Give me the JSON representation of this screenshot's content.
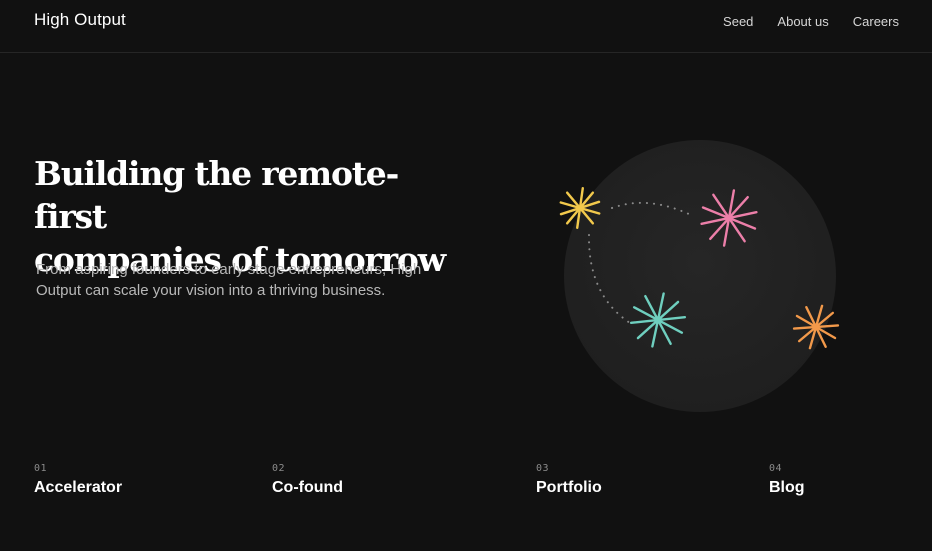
{
  "header": {
    "brand": "High Output",
    "nav": [
      {
        "label": "Seed"
      },
      {
        "label": "About us"
      },
      {
        "label": "Careers"
      }
    ]
  },
  "hero": {
    "title_line1": "Building the remote-first",
    "title_line2": "companies of tomorrow",
    "subtitle": "From aspiring founders to early stage entrepreneurs, High Output can scale your vision into a thriving business."
  },
  "illustration": {
    "circle_color": "#232323",
    "stars": [
      {
        "name": "yellow-star-icon",
        "color": "#f2c94c"
      },
      {
        "name": "pink-star-icon",
        "color": "#ec7fa9"
      },
      {
        "name": "teal-star-icon",
        "color": "#6fcfbf"
      },
      {
        "name": "orange-star-icon",
        "color": "#f2994a"
      }
    ]
  },
  "sections": [
    {
      "num": "01",
      "label": "Accelerator"
    },
    {
      "num": "02",
      "label": "Co-found"
    },
    {
      "num": "03",
      "label": "Portfolio"
    },
    {
      "num": "04",
      "label": "Blog"
    }
  ],
  "colors": {
    "background": "#111111",
    "text": "#ffffff",
    "muted": "#b8b8b8"
  }
}
